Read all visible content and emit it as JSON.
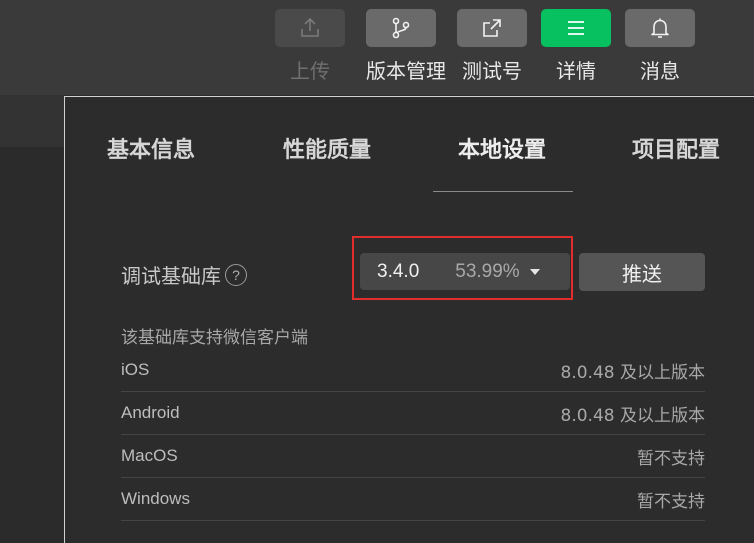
{
  "toolbar": {
    "items": [
      {
        "label": "上传",
        "icon": "upload-icon",
        "disabled": true
      },
      {
        "label": "版本管理",
        "icon": "branch-icon"
      },
      {
        "label": "测试号",
        "icon": "external-link-icon"
      },
      {
        "label": "详情",
        "icon": "menu-icon",
        "active": true
      },
      {
        "label": "消息",
        "icon": "bell-icon"
      }
    ]
  },
  "tabs": [
    {
      "label": "基本信息"
    },
    {
      "label": "性能质量"
    },
    {
      "label": "本地设置",
      "active": true
    },
    {
      "label": "项目配置"
    }
  ],
  "library": {
    "label": "调试基础库",
    "help": "?",
    "version": "3.4.0",
    "percent": "53.99%",
    "push_label": "推送"
  },
  "support": {
    "title": "该基础库支持微信客户端",
    "rows": [
      {
        "platform": "iOS",
        "requirement": "8.0.48 及以上版本"
      },
      {
        "platform": "Android",
        "requirement": "8.0.48 及以上版本"
      },
      {
        "platform": "MacOS",
        "requirement": "暂不支持"
      },
      {
        "platform": "Windows",
        "requirement": "暂不支持"
      }
    ]
  },
  "colors": {
    "accent": "#07c160",
    "highlight": "#e32c2c"
  }
}
